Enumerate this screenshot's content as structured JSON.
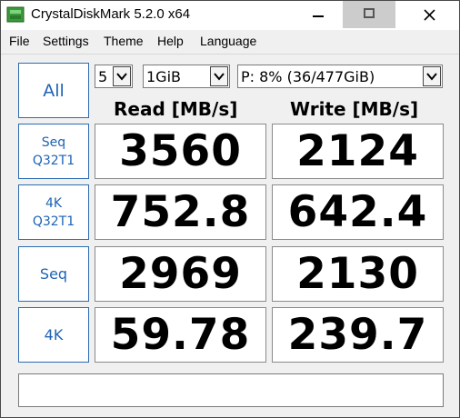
{
  "window": {
    "title": "CrystalDiskMark 5.2.0 x64"
  },
  "menu": {
    "items": [
      "File",
      "Settings",
      "Theme",
      "Help",
      "Language"
    ]
  },
  "controls": {
    "all_label": "All",
    "count_value": "5",
    "size_value": "1GiB",
    "drive_value": "P: 8% (36/477GiB)"
  },
  "headers": {
    "read": "Read [MB/s]",
    "write": "Write [MB/s]"
  },
  "tests": [
    {
      "label": "Seq\nQ32T1",
      "read": "3560",
      "write": "2124"
    },
    {
      "label": "4K\nQ32T1",
      "read": "752.8",
      "write": "642.4"
    },
    {
      "label": "Seq",
      "read": "2969",
      "write": "2130"
    },
    {
      "label": "4K",
      "read": "59.78",
      "write": "239.7"
    }
  ],
  "status": {
    "text": ""
  },
  "icons": {
    "app": "disk-icon",
    "minimize": "minimize-icon",
    "maximize": "maximize-icon",
    "close": "close-icon",
    "dropdown": "chevron-down-icon"
  },
  "colors": {
    "accent": "#1e63b5",
    "client_bg": "#f0f0f0",
    "max_button_bg": "#cccccc"
  }
}
